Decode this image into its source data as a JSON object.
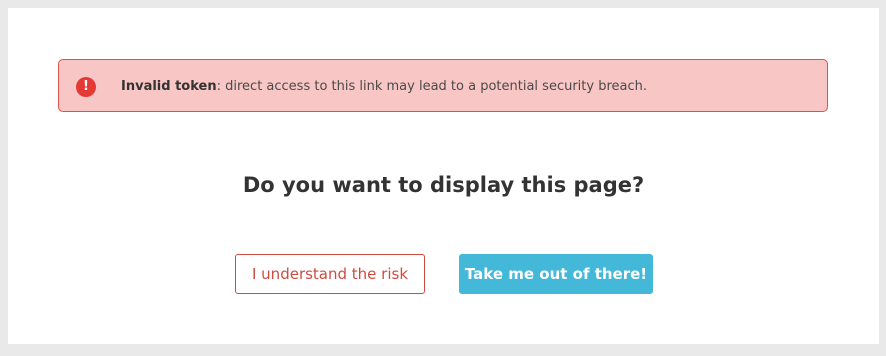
{
  "alert": {
    "icon": "exclamation-circle-icon",
    "icon_glyph": "!",
    "title": "Invalid token",
    "message": ": direct access to this link may lead to a potential security breach.",
    "colors": {
      "background": "#f8c6c4",
      "border": "#d9534f",
      "icon": "#e53935"
    }
  },
  "main": {
    "headline": "Do you want to display this page?"
  },
  "actions": {
    "risk_label": "I understand the risk",
    "leave_label": "Take me out of there!",
    "colors": {
      "risk": "#cf4b40",
      "leave": "#43b8d9"
    }
  }
}
